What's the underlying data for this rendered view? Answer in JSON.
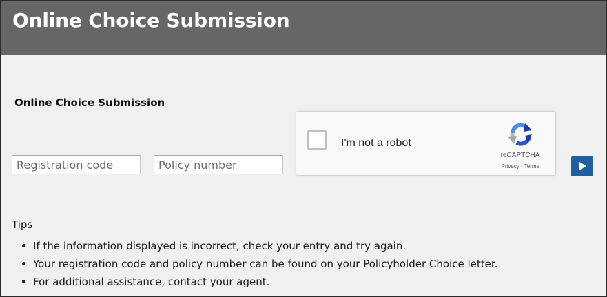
{
  "header": {
    "title": "Online Choice Submission"
  },
  "form": {
    "title": "Online Choice Submission",
    "registration_code": {
      "value": "",
      "placeholder": "Registration code"
    },
    "policy_number": {
      "value": "",
      "placeholder": "Policy number"
    },
    "submit_icon": "play-arrow-icon"
  },
  "captcha": {
    "label": "I'm not a robot",
    "brand": "reCAPTCHA",
    "privacy": "Privacy",
    "separator": "-",
    "terms": "Terms",
    "logo_icon": "recaptcha-logo-icon",
    "checked": false
  },
  "tips": {
    "title": "Tips",
    "items": [
      "If the information displayed is incorrect, check your entry and try again.",
      "Your registration code and policy number can be found on your Policyholder Choice letter.",
      "For additional assistance, contact your agent."
    ]
  },
  "colors": {
    "header_bg": "#666666",
    "page_bg": "#f0f0f0",
    "submit_bg": "#1f5f9e"
  }
}
